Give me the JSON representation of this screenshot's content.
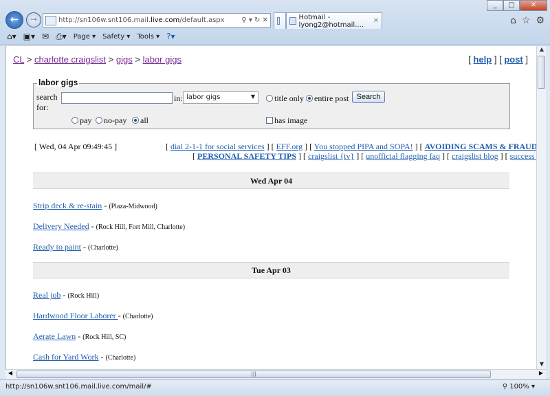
{
  "browser": {
    "address_prefix": "http://sn106w.snt106.mail.",
    "address_bold": "live.com",
    "address_suffix": "/default.aspx",
    "tab_title": "Hotmail - lyong2@hotmail....",
    "command_bar": {
      "page": "Page",
      "safety": "Safety",
      "tools": "Tools"
    },
    "status_text": "http://sn106w.snt106.mail.live.com/mail/#",
    "zoom": "100%"
  },
  "page": {
    "breadcrumb": {
      "cl": "CL",
      "sep": ">",
      "city": "charlotte craigslist",
      "gigs": "gigs",
      "labor": "labor gigs"
    },
    "help": "help",
    "post": "post",
    "search": {
      "legend": "labor gigs",
      "search_label": "search",
      "for_label": "for:",
      "in_label": "in:",
      "category": "labor gigs",
      "title_only": "title only",
      "entire_post": "entire post",
      "button": "Search",
      "pay": "pay",
      "no_pay": "no-pay",
      "all": "all",
      "has_image": "has image"
    },
    "date": "[ Wed, 04 Apr 09:49:45 ]",
    "links": {
      "dial": "dial 2-1-1 for social services",
      "eff": "EFF.org",
      "pipa": "You stopped PIPA and SOPA!",
      "scams": "AVOIDING SCAMS & FRAUD",
      "safety": "PERSONAL SAFETY TIPS",
      "tv": "craigslist {tv}",
      "flagging": "unofficial flagging faq",
      "blog": "craigslist blog",
      "success": "success stories"
    },
    "days": [
      {
        "header": "Wed Apr 04",
        "posts": [
          {
            "title": "Strip deck & re-stain",
            "location": "(Plaza-Midwood)"
          },
          {
            "title": "Delivery Needed",
            "location": "(Rock Hill, Fort Mill, Charlotte)"
          },
          {
            "title": "Ready to paint",
            "location": "(Charlotte)"
          }
        ]
      },
      {
        "header": "Tue Apr 03",
        "posts": [
          {
            "title": "Real job",
            "location": "(Rock Hill)"
          },
          {
            "title": "Hardwood Floor Laborer ",
            "location": "(Charlotte)"
          },
          {
            "title": "Aerate Lawn",
            "location": "(Rock Hill, SC)"
          },
          {
            "title": "Cash for Yard Work",
            "location": "(Charlotte)"
          }
        ]
      }
    ]
  }
}
